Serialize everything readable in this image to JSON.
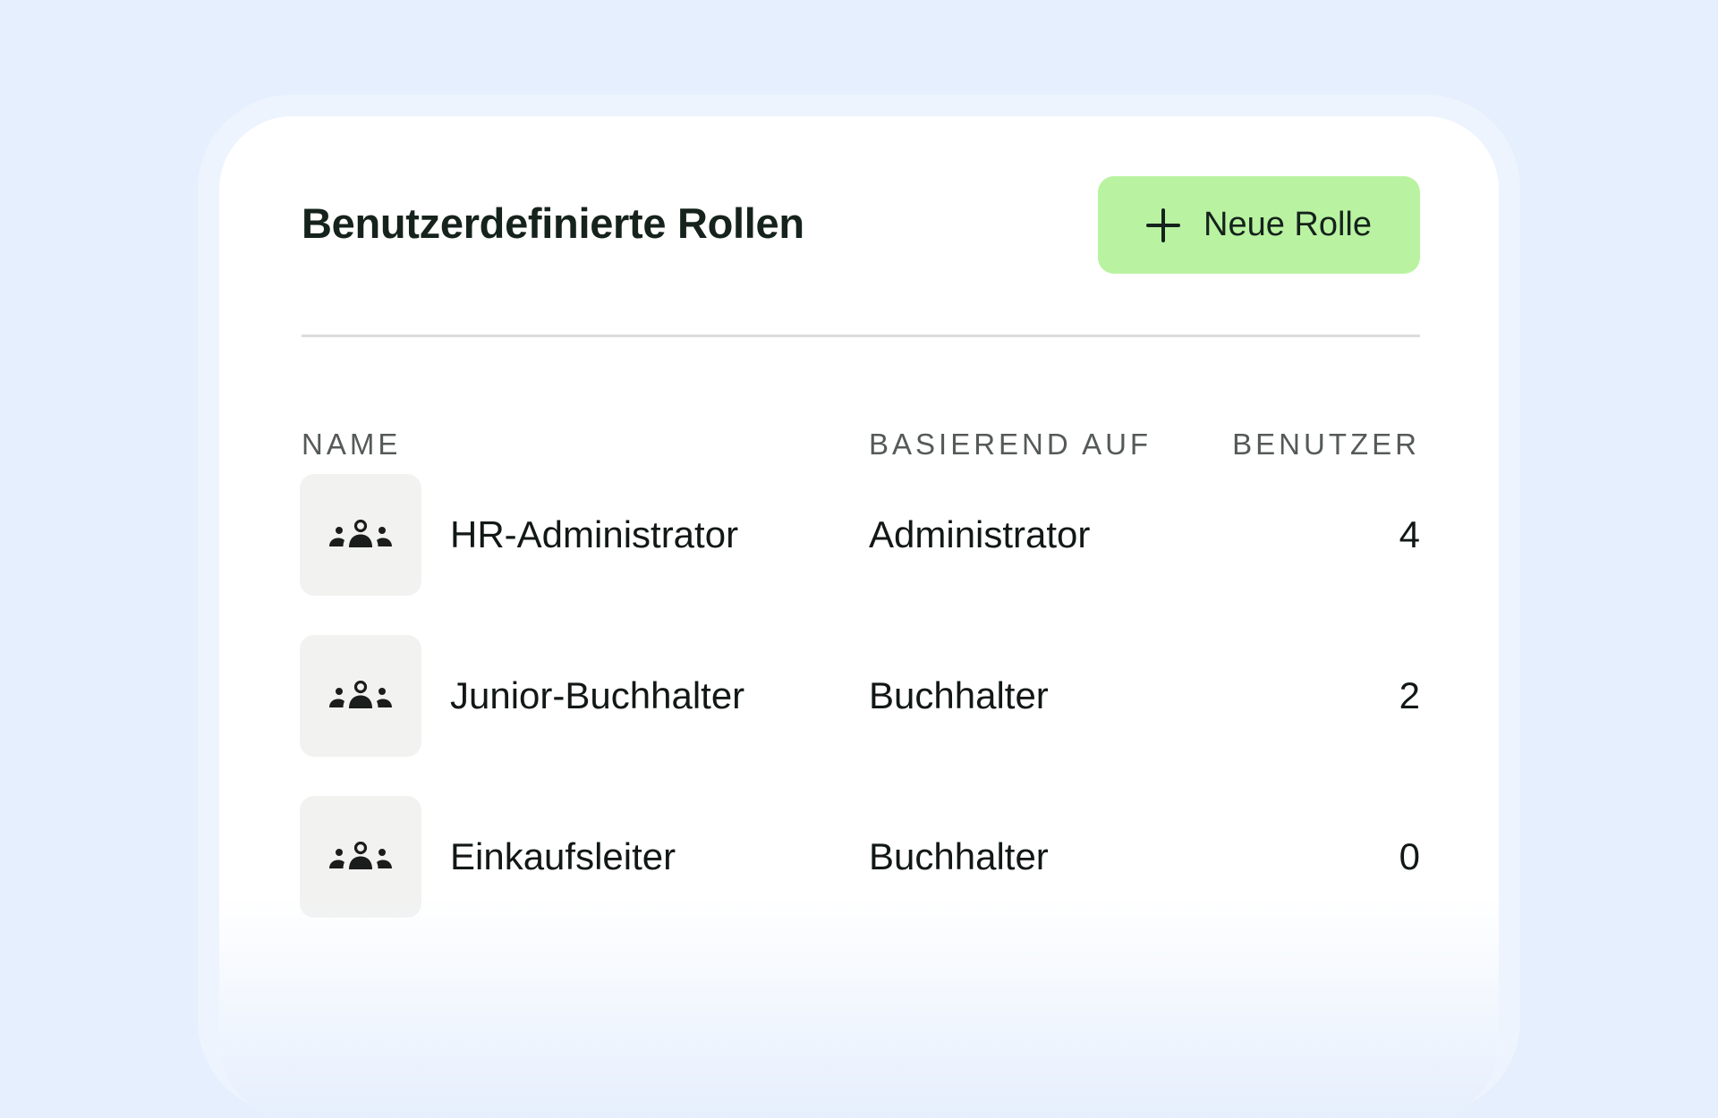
{
  "header": {
    "title": "Benutzerdefinierte Rollen",
    "new_button_label": "Neue Rolle"
  },
  "table": {
    "columns": {
      "name": "NAME",
      "based_on": "BASIEREND AUF",
      "users": "BENUTZER"
    },
    "rows": [
      {
        "name": "HR-Administrator",
        "based_on": "Administrator",
        "users": "4",
        "icon": "users-group-icon"
      },
      {
        "name": "Junior-Buchhalter",
        "based_on": "Buchhalter",
        "users": "2",
        "icon": "users-group-icon"
      },
      {
        "name": "Einkaufsleiter",
        "based_on": "Buchhalter",
        "users": "0",
        "icon": "users-group-icon"
      }
    ]
  },
  "colors": {
    "background": "#e6effd",
    "card": "#ffffff",
    "accent_button": "#b9f3a1",
    "icon_tile": "#f2f2f1",
    "text": "#15231c"
  }
}
